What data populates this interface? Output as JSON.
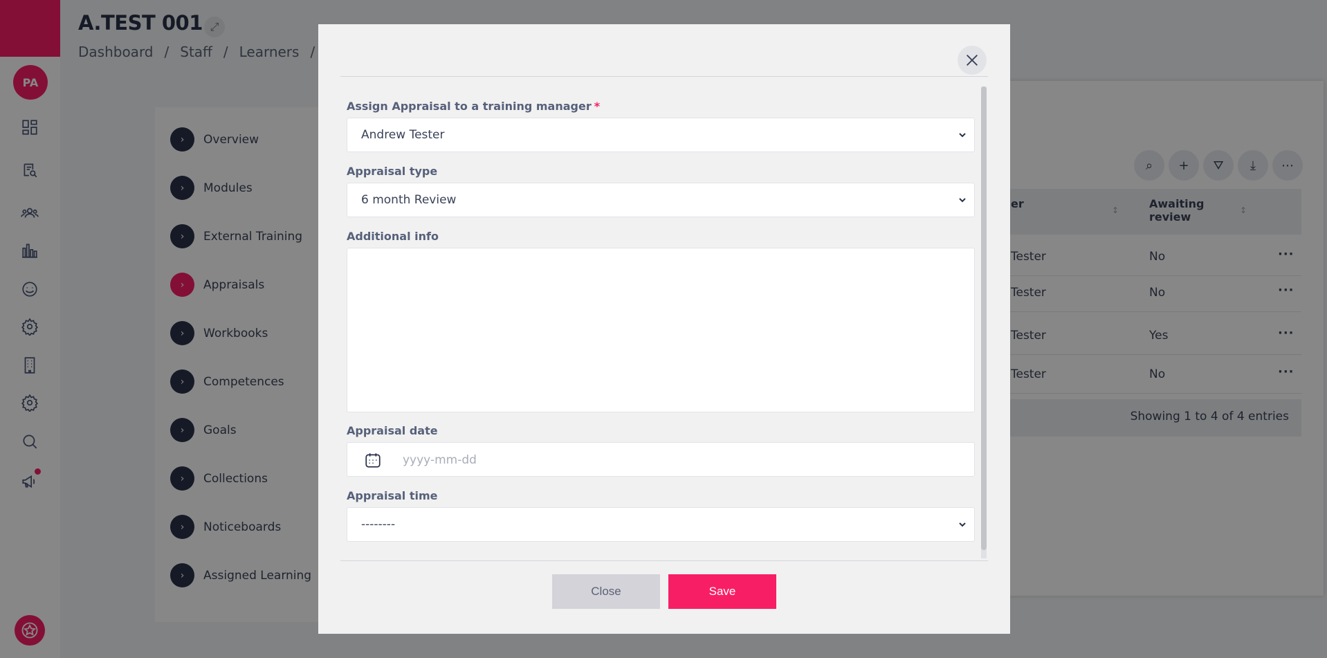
{
  "sidebar": {
    "avatar_initials": "PA",
    "icons": [
      "dashboard-icon",
      "search-document-icon",
      "users-icon",
      "bar-chart-icon",
      "smiley-icon",
      "gear-icon",
      "building-icon",
      "settings-icon",
      "search-icon",
      "megaphone-icon"
    ],
    "brand_color": "#f81e66"
  },
  "page": {
    "title": "A.TEST 001",
    "breadcrumb": [
      "Dashboard",
      "/",
      "Staff",
      "/",
      "Learners",
      "/"
    ]
  },
  "left_menu": {
    "items": [
      {
        "label": "Overview",
        "active": false
      },
      {
        "label": "Modules",
        "active": false
      },
      {
        "label": "External Training",
        "active": false
      },
      {
        "label": "Appraisals",
        "active": true
      },
      {
        "label": "Workbooks",
        "active": false
      },
      {
        "label": "Competences",
        "active": false
      },
      {
        "label": "Goals",
        "active": false
      },
      {
        "label": "Collections",
        "active": false
      },
      {
        "label": "Noticeboards",
        "active": false
      },
      {
        "label": "Assigned Learning",
        "active": false
      }
    ]
  },
  "table": {
    "headers": [
      "er",
      "Awaiting review"
    ],
    "rows": [
      {
        "manager": "Tester",
        "awaiting": "No"
      },
      {
        "manager": "Tester",
        "awaiting": "No"
      },
      {
        "manager": "Tester",
        "awaiting": "Yes"
      },
      {
        "manager": "Tester",
        "awaiting": "No"
      }
    ],
    "row_menu": "···",
    "footer": "Showing 1 to 4 of 4 entries"
  },
  "modal": {
    "manager_label": "Assign Appraisal to a training manager",
    "required_mark": "*",
    "manager_value": "Andrew Tester",
    "type_label": "Appraisal type",
    "type_value": "6 month Review",
    "info_label": "Additional info",
    "info_value": "",
    "date_label": "Appraisal date",
    "date_placeholder": "yyyy-mm-dd",
    "time_label": "Appraisal time",
    "time_value": "--------",
    "close_label": "Close",
    "save_label": "Save"
  }
}
